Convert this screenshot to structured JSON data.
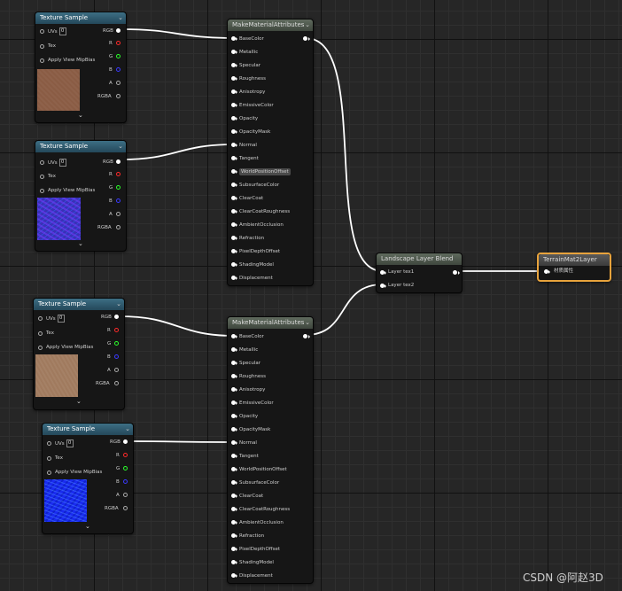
{
  "texture_nodes": [
    {
      "title": "Texture Sample",
      "uvs": "UVs",
      "uv_value": "0",
      "tex": "Tex",
      "mip": "Apply View MipBias",
      "rgb": "RGB",
      "r": "R",
      "g": "G",
      "b": "B",
      "a": "A",
      "rgba": "RGBA",
      "thumb": "brown",
      "collapse": "⌄"
    },
    {
      "title": "Texture Sample",
      "uvs": "UVs",
      "uv_value": "0",
      "tex": "Tex",
      "mip": "Apply View MipBias",
      "rgb": "RGB",
      "r": "R",
      "g": "G",
      "b": "B",
      "a": "A",
      "rgba": "RGBA",
      "thumb": "normal",
      "collapse": "⌄"
    },
    {
      "title": "Texture Sample",
      "uvs": "UVs",
      "uv_value": "0",
      "tex": "Tex",
      "mip": "Apply View MipBias",
      "rgb": "RGB",
      "r": "R",
      "g": "G",
      "b": "B",
      "a": "A",
      "rgba": "RGBA",
      "thumb": "tan",
      "collapse": "⌄"
    },
    {
      "title": "Texture Sample",
      "uvs": "UVs",
      "uv_value": "0",
      "tex": "Tex",
      "mip": "Apply View MipBias",
      "rgb": "RGB",
      "r": "R",
      "g": "G",
      "b": "B",
      "a": "A",
      "rgba": "RGBA",
      "thumb": "blue",
      "collapse": "⌄"
    }
  ],
  "make_nodes": [
    {
      "title": "MakeMaterialAttributes",
      "collapse": "⌄"
    },
    {
      "title": "MakeMaterialAttributes",
      "collapse": "⌄"
    }
  ],
  "make_pins": [
    "BaseColor",
    "Metallic",
    "Specular",
    "Roughness",
    "Anisotropy",
    "EmissiveColor",
    "Opacity",
    "OpacityMask",
    "Normal",
    "Tangent",
    "WorldPositionOffset",
    "SubsurfaceColor",
    "ClearCoat",
    "ClearCoatRoughness",
    "AmbientOcclusion",
    "Refraction",
    "PixelDepthOffset",
    "ShadingModel",
    "Displacement"
  ],
  "blend_node": {
    "title": "Landscape Layer Blend",
    "layer1": "Layer tex1",
    "layer2": "Layer tex2"
  },
  "output_node": {
    "title": "TerrainMat2Layer",
    "pin": "材质属性"
  },
  "watermark": "CSDN @阿赵3D",
  "colors": {
    "wire": "#ffffff",
    "r_pin": "#ff2a2a",
    "g_pin": "#2aff2a",
    "b_pin": "#3a3aff",
    "highlight": "#f5a623",
    "tex_header": "#315a6e"
  }
}
